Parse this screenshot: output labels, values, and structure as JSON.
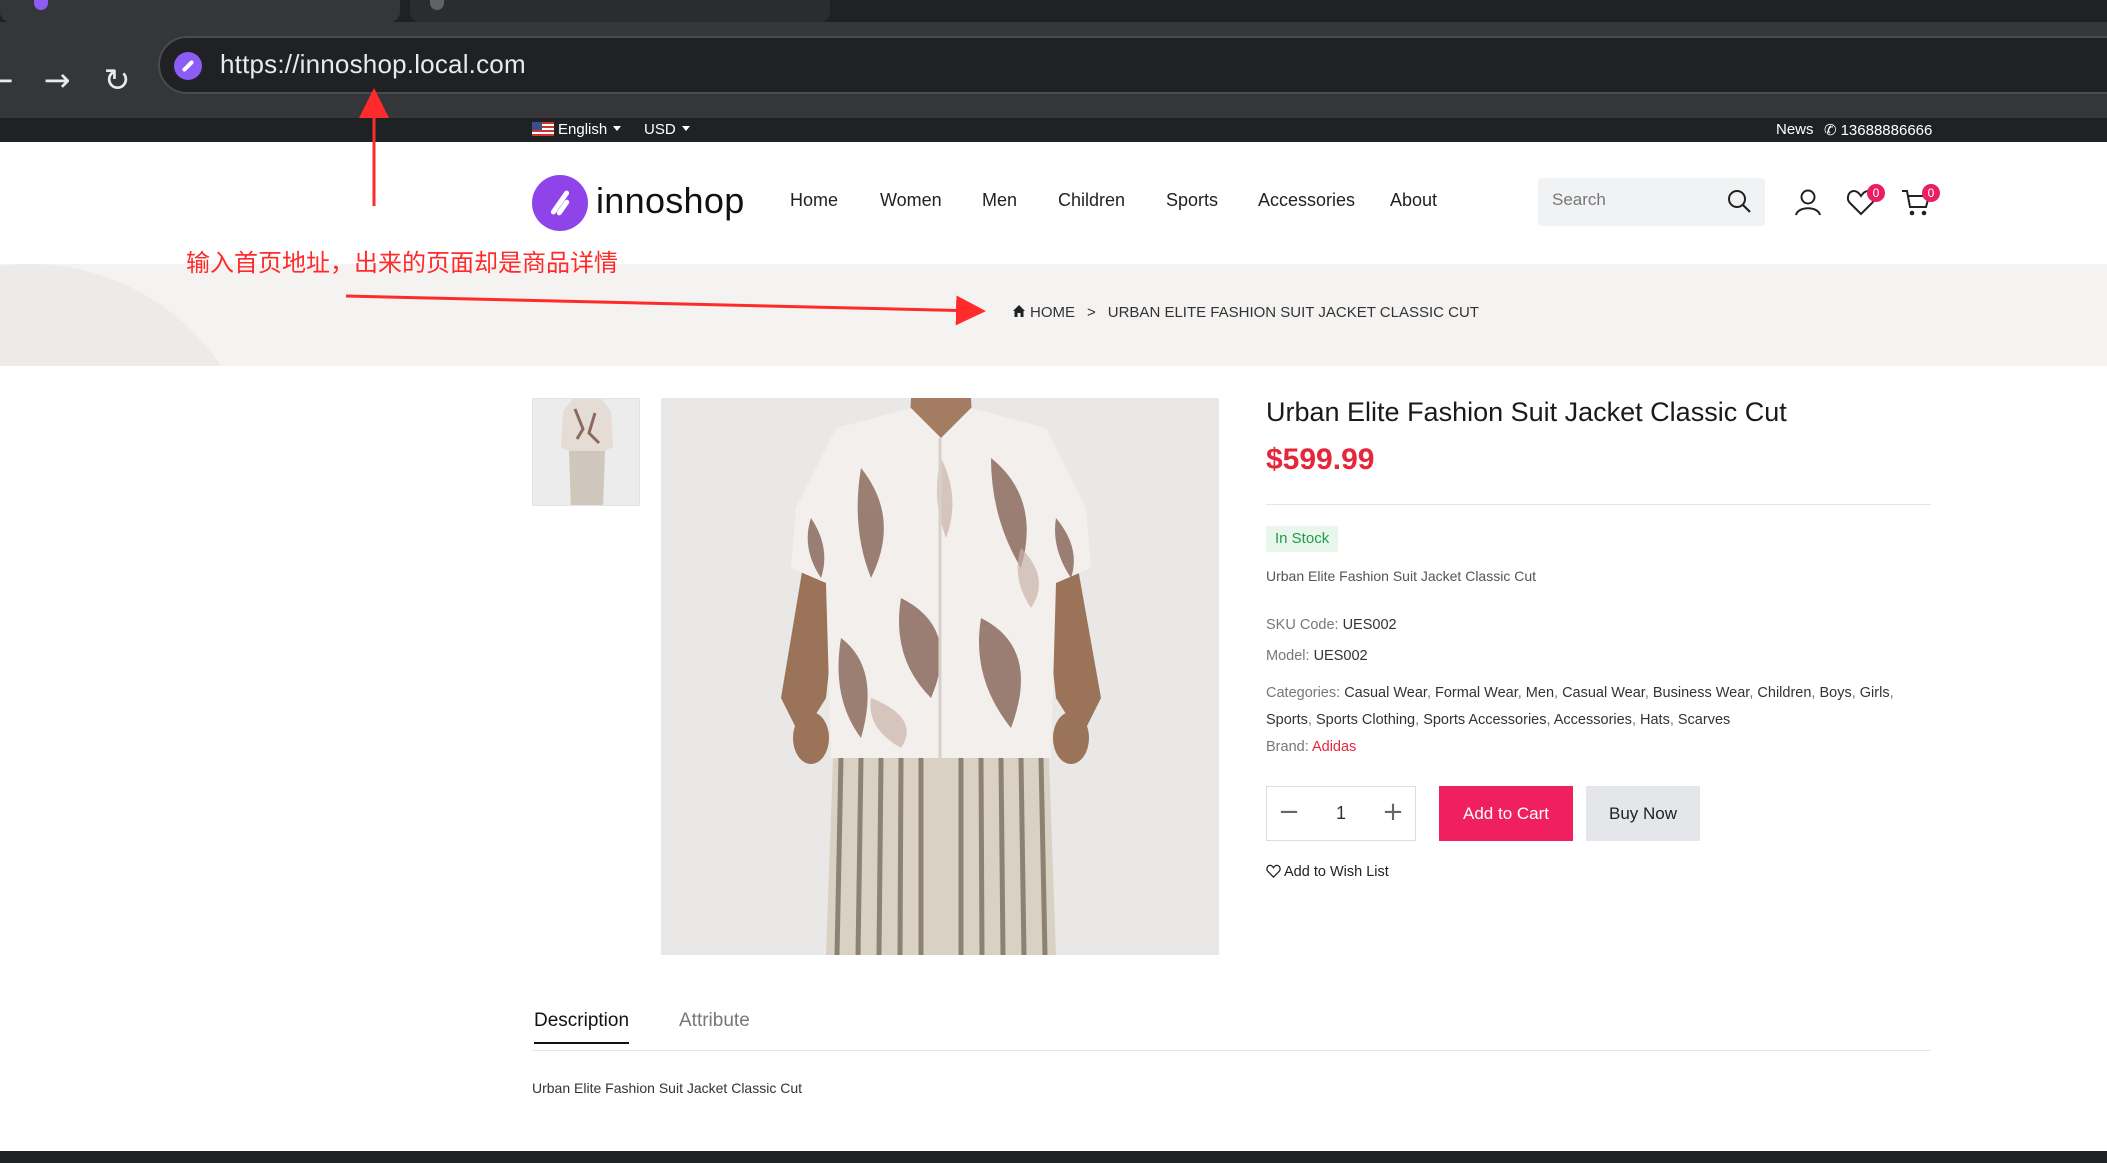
{
  "browser": {
    "url": "https://innoshop.local.com",
    "back_glyph": "←",
    "forward_glyph": "→",
    "reload_glyph": "↻"
  },
  "topbar": {
    "language": "English",
    "currency": "USD",
    "news": "News",
    "phone": "13688886666"
  },
  "header": {
    "logo_text": "innoshop",
    "nav": [
      "Home",
      "Women",
      "Men",
      "Children",
      "Sports",
      "Accessories",
      "About"
    ],
    "search_placeholder": "Search",
    "wishlist_count": "0",
    "cart_count": "0"
  },
  "breadcrumb": {
    "home": "HOME",
    "separator": ">",
    "current": "URBAN ELITE FASHION SUIT JACKET CLASSIC CUT"
  },
  "annotation": {
    "text": "输入首页地址，出来的页面却是商品详情",
    "color": "#ff2a2a"
  },
  "product": {
    "title": "Urban Elite Fashion Suit Jacket Classic Cut",
    "price": "$599.99",
    "stock": "In Stock",
    "summary": "Urban Elite Fashion Suit Jacket Classic Cut",
    "sku_label": "SKU Code:",
    "sku": "UES002",
    "model_label": "Model:",
    "model": "UES002",
    "categories_label": "Categories:",
    "categories": [
      "Casual Wear",
      "Formal Wear",
      "Men",
      "Casual Wear",
      "Business Wear",
      "Children",
      "Boys",
      "Girls",
      "Sports",
      "Sports Clothing",
      "Sports Accessories",
      "Accessories",
      "Hats",
      "Scarves"
    ],
    "brand_label": "Brand:",
    "brand": "Adidas",
    "quantity": "1",
    "minus": "−",
    "plus": "+",
    "add_to_cart": "Add to Cart",
    "buy_now": "Buy Now",
    "add_to_wishlist": "Add to Wish List"
  },
  "tabs": {
    "description": "Description",
    "attribute": "Attribute",
    "description_body": "Urban Elite Fashion Suit Jacket Classic Cut"
  },
  "colors": {
    "accent": "#ef1f60",
    "price": "#e6263a",
    "brand_purple": "#8e44e8",
    "stock_green": "#1e9e4a"
  }
}
